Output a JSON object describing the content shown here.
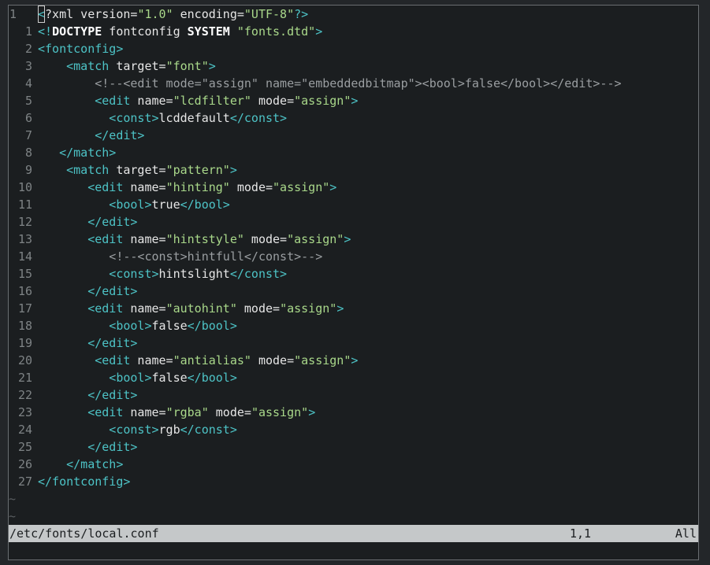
{
  "editor": {
    "lines": [
      {
        "n": "1"
      },
      {
        "n": "1"
      },
      {
        "n": "2"
      },
      {
        "n": "3"
      },
      {
        "n": "4"
      },
      {
        "n": "5"
      },
      {
        "n": "6"
      },
      {
        "n": "7"
      },
      {
        "n": "8"
      },
      {
        "n": "9"
      },
      {
        "n": "10"
      },
      {
        "n": "11"
      },
      {
        "n": "12"
      },
      {
        "n": "13"
      },
      {
        "n": "14"
      },
      {
        "n": "15"
      },
      {
        "n": "16"
      },
      {
        "n": "17"
      },
      {
        "n": "18"
      },
      {
        "n": "19"
      },
      {
        "n": "20"
      },
      {
        "n": "21"
      },
      {
        "n": "22"
      },
      {
        "n": "23"
      },
      {
        "n": "24"
      },
      {
        "n": "25"
      },
      {
        "n": "26"
      },
      {
        "n": "27"
      }
    ],
    "code": {
      "l0_a": "<",
      "l0_b": "?xml version=",
      "l0_c": "\"1.0\"",
      "l0_d": " encoding=",
      "l0_e": "\"UTF-8\"",
      "l0_f": "?>",
      "l1_a": "<!",
      "l1_b": "DOCTYPE",
      "l1_c": " fontconfig ",
      "l1_d": "SYSTEM",
      "l1_e": " ",
      "l1_f": "\"fonts.dtd\"",
      "l1_g": ">",
      "l2": "<fontconfig>",
      "l3_a": "    <match",
      "l3_b": " target=",
      "l3_c": "\"font\"",
      "l3_d": ">",
      "l4": "        <!--<edit mode=\"assign\" name=\"embeddedbitmap\"><bool>false</bool></edit>-->",
      "l5_a": "        <edit",
      "l5_b": " name=",
      "l5_c": "\"lcdfilter\"",
      "l5_d": " mode=",
      "l5_e": "\"assign\"",
      "l5_f": ">",
      "l6_a": "          <const>",
      "l6_b": "lcddefault",
      "l6_c": "</const>",
      "l7": "        </edit>",
      "l8": "   </match>",
      "l9_a": "    <match",
      "l9_b": " target=",
      "l9_c": "\"pattern\"",
      "l9_d": ">",
      "l10_a": "       <edit",
      "l10_b": " name=",
      "l10_c": "\"hinting\"",
      "l10_d": " mode=",
      "l10_e": "\"assign\"",
      "l10_f": ">",
      "l11_a": "          <bool>",
      "l11_b": "true",
      "l11_c": "</bool>",
      "l12": "       </edit>",
      "l13_a": "       <edit",
      "l13_b": " name=",
      "l13_c": "\"hintstyle\"",
      "l13_d": " mode=",
      "l13_e": "\"assign\"",
      "l13_f": ">",
      "l14": "          <!--<const>hintfull</const>-->",
      "l15_a": "          <const>",
      "l15_b": "hintslight",
      "l15_c": "</const>",
      "l16": "       </edit>",
      "l17_a": "       <edit",
      "l17_b": " name=",
      "l17_c": "\"autohint\"",
      "l17_d": " mode=",
      "l17_e": "\"assign\"",
      "l17_f": ">",
      "l18_a": "          <bool>",
      "l18_b": "false",
      "l18_c": "</bool>",
      "l19": "       </edit>",
      "l20_a": "        <edit",
      "l20_b": " name=",
      "l20_c": "\"antialias\"",
      "l20_d": " mode=",
      "l20_e": "\"assign\"",
      "l20_f": ">",
      "l21_a": "          <bool>",
      "l21_b": "false",
      "l21_c": "</bool>",
      "l22": "       </edit>",
      "l23_a": "       <edit",
      "l23_b": " name=",
      "l23_c": "\"rgba\"",
      "l23_d": " mode=",
      "l23_e": "\"assign\"",
      "l23_f": ">",
      "l24_a": "          <const>",
      "l24_b": "rgb",
      "l24_c": "</const>",
      "l25": "       </edit>",
      "l26": "    </match>",
      "l27": "</fontconfig>"
    },
    "empty_marker": "~"
  },
  "statusbar": {
    "filename": "/etc/fonts/local.conf",
    "position": "1,1",
    "scroll": "All"
  },
  "colors": {
    "background": "#1b1e20",
    "tag": "#4dc3c6",
    "string": "#a9d88a",
    "comment": "#9a9ea1",
    "line_number": "#7e8385",
    "statusbar": "#c5c8c9"
  }
}
